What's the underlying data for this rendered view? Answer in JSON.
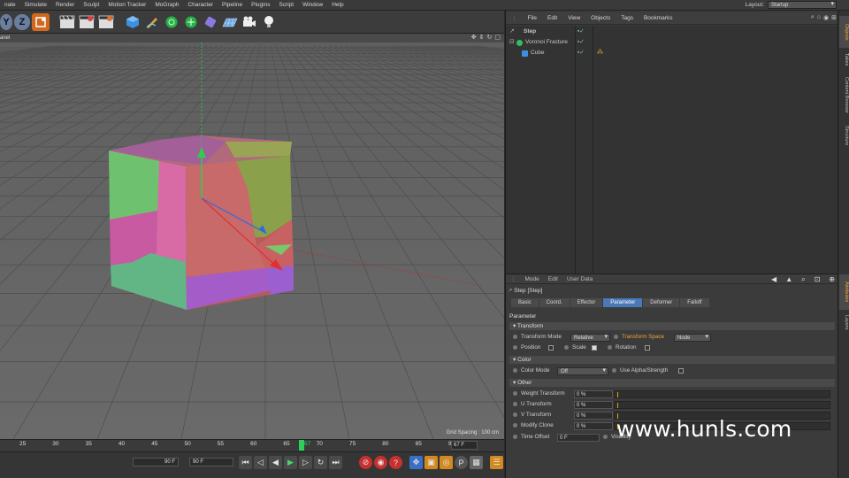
{
  "menubar": {
    "items": [
      "nate",
      "Simulate",
      "Render",
      "Sculpt",
      "Motion Tracker",
      "MoGraph",
      "Character",
      "Pipeline",
      "Plugins",
      "Script",
      "Window",
      "Help"
    ],
    "layout_label": "Layout:",
    "layout_value": "Startup"
  },
  "viewport": {
    "title": "anel",
    "grid_spacing": "Grid Spacing : 100 cm"
  },
  "timeline": {
    "ticks": [
      "25",
      "30",
      "35",
      "40",
      "45",
      "50",
      "55",
      "60",
      "65",
      "70",
      "75",
      "80",
      "85",
      "90"
    ],
    "current": "67",
    "frame_field": "67 F"
  },
  "transport": {
    "left_field": "90 F",
    "right_field": "90 F"
  },
  "object_manager": {
    "menu": [
      "File",
      "Edit",
      "View",
      "Objects",
      "Tags",
      "Bookmarks"
    ],
    "objects": [
      {
        "name": "Step",
        "color": "#f0a43a"
      },
      {
        "name": "Voronoi Fracture",
        "color": "#d8d8d8"
      },
      {
        "name": "Cube",
        "color": "#d8d8d8"
      }
    ]
  },
  "attributes": {
    "menu": [
      "Mode",
      "Edit",
      "User Data"
    ],
    "title": "Step [Step]",
    "tabs": [
      "Basic",
      "Coord.",
      "Effector",
      "Parameter",
      "Deformer",
      "Falloff"
    ],
    "active_tab": "Parameter",
    "section_parameter": "Parameter",
    "transform_head": "Transform",
    "transform_mode_label": "Transform Mode",
    "transform_mode_value": "Relative",
    "transform_space_label": "Transform Space",
    "transform_space_value": "Node",
    "position_label": "Position",
    "scale_label": "Scale",
    "rotation_label": "Rotation",
    "color_head": "Color",
    "color_mode_label": "Color Mode",
    "color_mode_value": "Off",
    "alpha_label": "Use Alpha/Strength",
    "other_head": "Other",
    "weight_label": "Weight Transform",
    "weight_value": "0 %",
    "u_label": "U Transform",
    "u_value": "0 %",
    "v_label": "V Transform",
    "v_value": "0 %",
    "modify_label": "Modify Clone",
    "modify_value": "0 %",
    "time_label": "Time Offset",
    "time_value": "0 F",
    "visibility_label": "Visibility"
  },
  "sidetabs": [
    "Objects",
    "Takes",
    "Content Browser",
    "Structure",
    "Attributes",
    "Layers"
  ],
  "watermark": "www.hunls.com"
}
